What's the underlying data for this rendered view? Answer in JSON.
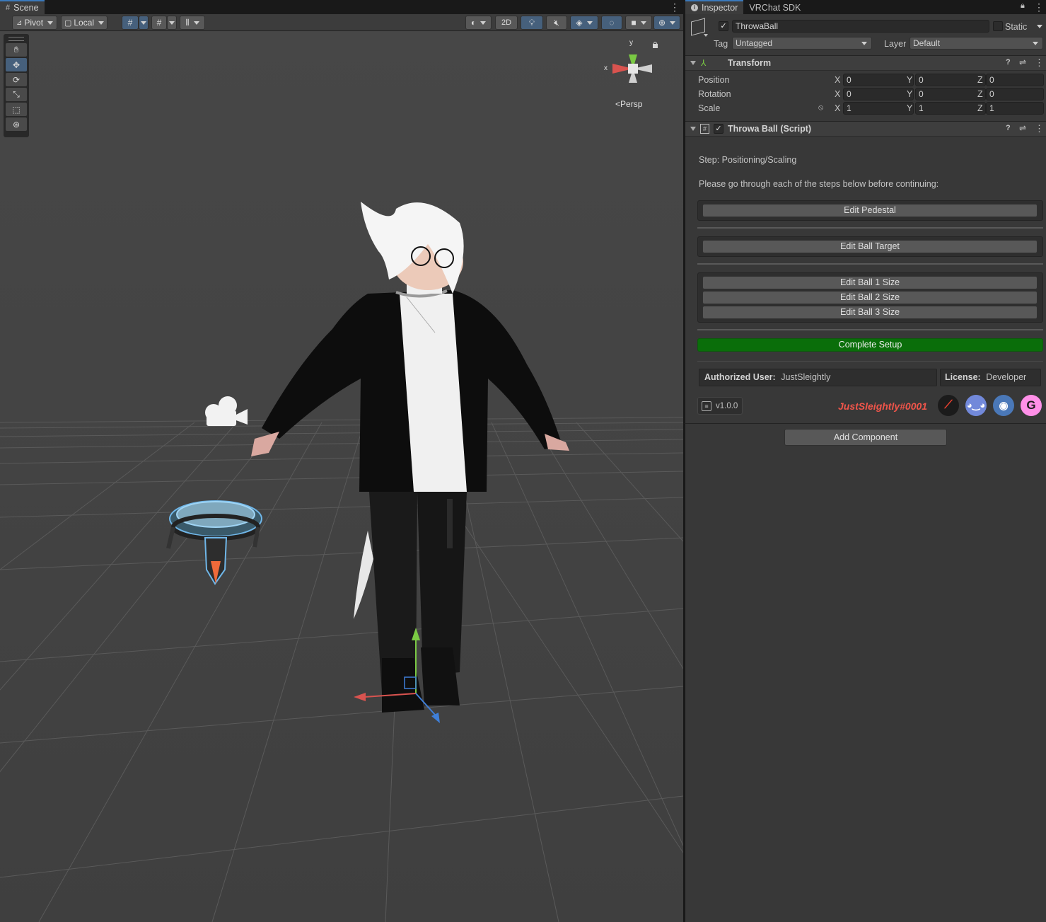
{
  "scene": {
    "tab_label": "Scene",
    "toolbar": {
      "pivot_label": "Pivot",
      "local_label": "Local",
      "mode_2d_label": "2D"
    },
    "gizmo": {
      "y_label": "y",
      "x_label": "x",
      "persp_label": "Persp"
    },
    "tools": [
      "hand-tool",
      "move-tool",
      "rotate-tool",
      "scale-tool",
      "rect-tool",
      "transform-tool"
    ]
  },
  "inspector": {
    "tabs": [
      {
        "label": "Inspector",
        "active": true
      },
      {
        "label": "VRChat SDK",
        "active": false
      }
    ],
    "object": {
      "name": "ThrowaBall",
      "active": true,
      "static_label": "Static",
      "tag_label": "Tag",
      "tag_value": "Untagged",
      "layer_label": "Layer",
      "layer_value": "Default"
    },
    "transform": {
      "title": "Transform",
      "rows": [
        {
          "label": "Position",
          "x": "0",
          "y": "0",
          "z": "0"
        },
        {
          "label": "Rotation",
          "x": "0",
          "y": "0",
          "z": "0"
        },
        {
          "label": "Scale",
          "x": "1",
          "y": "1",
          "z": "1"
        }
      ],
      "axis_x": "X",
      "axis_y": "Y",
      "axis_z": "Z"
    },
    "script": {
      "title": "Throwa Ball (Script)",
      "step_text": "Step: Positioning/Scaling",
      "instructions": "Please go through each of the steps below before continuing:",
      "edit_pedestal": "Edit Pedestal",
      "edit_ball_target": "Edit Ball Target",
      "edit_ball_1": "Edit Ball 1 Size",
      "edit_ball_2": "Edit Ball 2 Size",
      "edit_ball_3": "Edit Ball 3 Size",
      "complete_setup": "Complete Setup",
      "authorized_user_label": "Authorized User:",
      "authorized_user_value": "JustSleightly",
      "license_label": "License:",
      "license_value": "Developer",
      "version": "v1.0.0",
      "author_tag": "JustSleightly#0001"
    },
    "add_component": "Add Component"
  },
  "colors": {
    "accent_blue": "#3a79bb",
    "complete_green": "#0a6e0a",
    "author_red": "#f0554a",
    "gizmo_y": "#7ac943",
    "gizmo_x": "#d9534f",
    "gizmo_z": "#3f7fd8"
  }
}
